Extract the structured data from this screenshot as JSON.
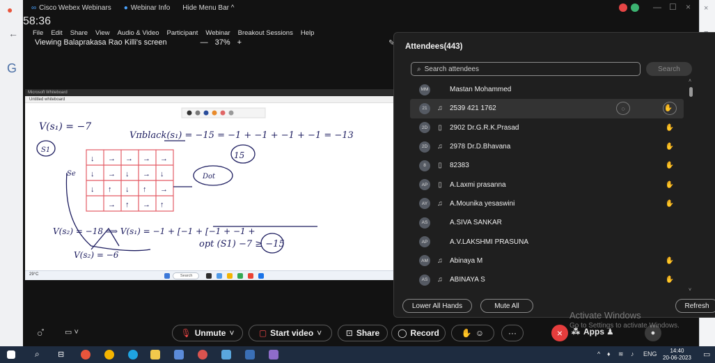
{
  "titlebar": {
    "app_name": "Cisco Webex Webinars",
    "info": "Webinar Info",
    "hide_menu": "Hide Menu Bar ^",
    "timer": "58:36"
  },
  "menu": [
    "File",
    "Edit",
    "Share",
    "View",
    "Audio & Video",
    "Participant",
    "Webinar",
    "Breakout Sessions",
    "Help"
  ],
  "viewbar": {
    "viewing": "Viewing Balaprakasa Rao Killi's screen",
    "zoom_out": "—",
    "zoom": "37%",
    "zoom_in": "+"
  },
  "shared_screen": {
    "app_title": "Microsoft Whiteboard",
    "doc_title": "Untitled whiteboard",
    "handwriting": {
      "line1": "V(s₁) = −7",
      "line2": "Vπblack(s₁) = −15 = −1 + −1 + −1 + −1 = −13",
      "circled": "15",
      "s1": "S1",
      "se": "Se",
      "dot": "Dot",
      "line3": "V(s₂) = −18 ⟹ V(s₁) = −1 + [−1 + [−1 + −1 +",
      "line4": "V(s₂) = −6",
      "line5": "opt (S1) −7 ≥ −15"
    },
    "taskbar_search": "Search",
    "taskbar_weather": "29°C"
  },
  "controls": {
    "unmute": "Unmute",
    "start_video": "Start video",
    "share": "Share",
    "record": "Record",
    "apps": "Apps"
  },
  "attendees": {
    "title": "Attendees(443)",
    "search_placeholder": "Search attendees",
    "search_button": "Search",
    "lower_all_hands": "Lower All Hands",
    "mute_all": "Mute All",
    "refresh": "Refresh",
    "list": [
      {
        "initials": "MM",
        "name": "Mastan Mohammed",
        "device": "",
        "hand": false
      },
      {
        "initials": "21",
        "name": "2539 421 1762",
        "device": "headset",
        "hand": true
      },
      {
        "initials": "2D",
        "name": "2902 Dr.G.R.K.Prasad",
        "device": "phone",
        "hand": true
      },
      {
        "initials": "2D",
        "name": "2978 Dr.D.Bhavana",
        "device": "headset",
        "hand": true
      },
      {
        "initials": "8",
        "name": "82383",
        "device": "phone",
        "hand": true
      },
      {
        "initials": "AP",
        "name": "A.Laxmi prasanna",
        "device": "phone",
        "hand": true
      },
      {
        "initials": "AY",
        "name": "A.Mounika yesaswini",
        "device": "headset",
        "hand": true
      },
      {
        "initials": "AS",
        "name": "A.SIVA SANKAR",
        "device": "",
        "hand": false
      },
      {
        "initials": "AP",
        "name": "A.V.LAKSHMI PRASUNA",
        "device": "",
        "hand": false
      },
      {
        "initials": "AM",
        "name": "Abinaya M",
        "device": "headset",
        "hand": true
      },
      {
        "initials": "AS",
        "name": "ABINAYA S",
        "device": "headset",
        "hand": true
      }
    ]
  },
  "watermark": {
    "line1": "Activate Windows",
    "line2": "Go to Settings to activate Windows."
  },
  "taskbar": {
    "lang": "ENG",
    "time": "14:40",
    "date": "20-06-2023"
  },
  "colors": {
    "panel_bg": "#1f1f1f",
    "window_bg": "#121212",
    "end_call": "#e63d3d",
    "raised_hand": "#ff6b4a",
    "taskbar": "#1e2c40"
  }
}
